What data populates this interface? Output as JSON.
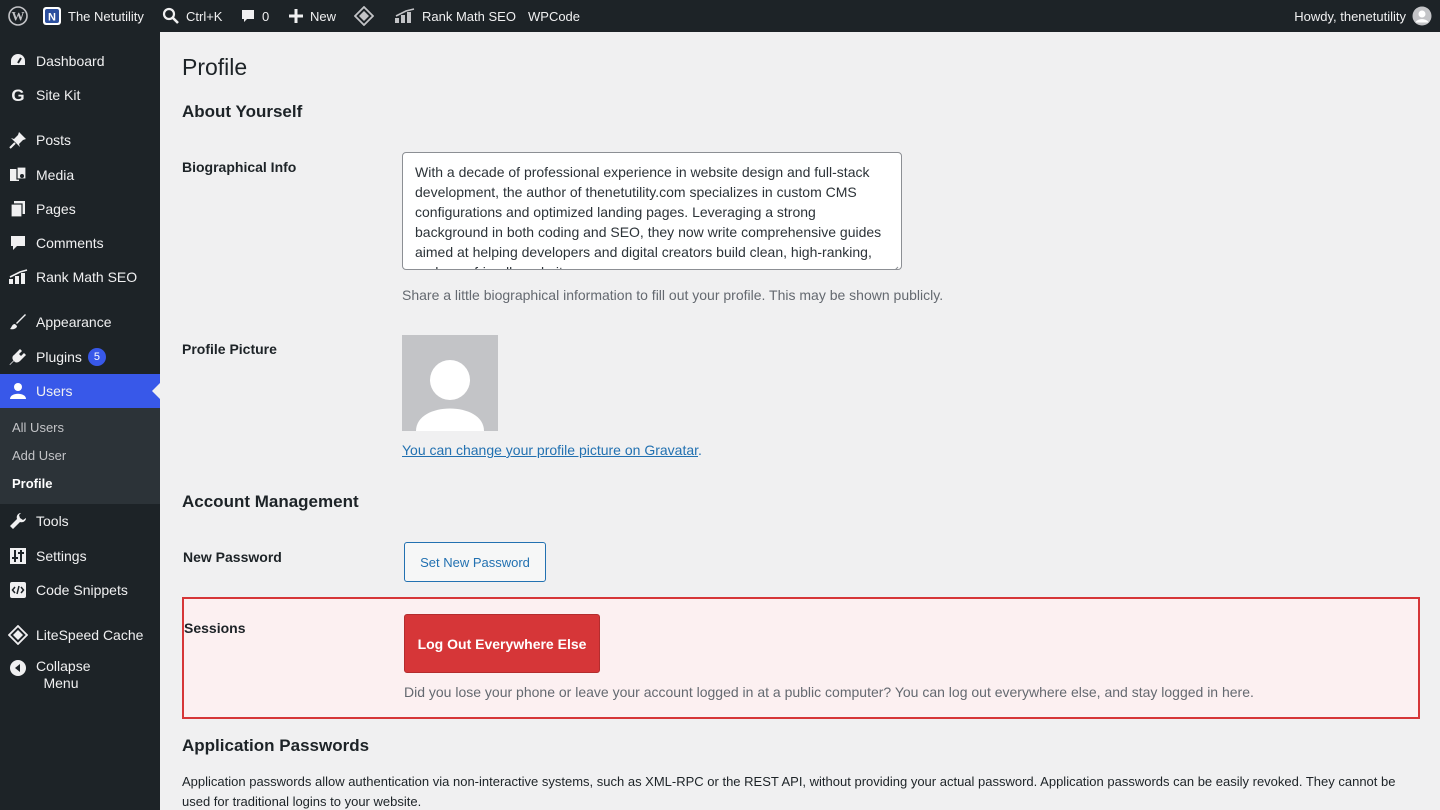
{
  "admin_bar": {
    "site_name": "The Netutility",
    "search_label": "Ctrl+K",
    "comments_count": "0",
    "new_label": "New",
    "rank_math_label": "Rank Math SEO",
    "wpcode_label": "WPCode",
    "howdy": "Howdy, thenetutility"
  },
  "sidebar": {
    "items": [
      {
        "label": "Dashboard",
        "icon": "dashboard-icon"
      },
      {
        "label": "Site Kit",
        "icon": "google-icon"
      },
      {
        "label": "Posts",
        "icon": "pin-icon"
      },
      {
        "label": "Media",
        "icon": "media-icon"
      },
      {
        "label": "Pages",
        "icon": "pages-icon"
      },
      {
        "label": "Comments",
        "icon": "comment-icon"
      },
      {
        "label": "Rank Math SEO",
        "icon": "chart-icon"
      },
      {
        "label": "Appearance",
        "icon": "brush-icon"
      },
      {
        "label": "Plugins",
        "icon": "plugin-icon",
        "badge": "5"
      },
      {
        "label": "Users",
        "icon": "user-icon"
      },
      {
        "label": "Tools",
        "icon": "wrench-icon"
      },
      {
        "label": "Settings",
        "icon": "sliders-icon"
      },
      {
        "label": "Code Snippets",
        "icon": "code-icon"
      },
      {
        "label": "LiteSpeed Cache",
        "icon": "diamond-icon"
      },
      {
        "label": "Collapse Menu",
        "icon": "collapse-icon"
      }
    ],
    "users_submenu": [
      {
        "label": "All Users"
      },
      {
        "label": "Add User"
      },
      {
        "label": "Profile"
      }
    ]
  },
  "page": {
    "title": "Profile",
    "about_heading": "About Yourself",
    "bio_label": "Biographical Info",
    "bio_text": "With a decade of professional experience in website design and full-stack development, the author of thenetutility.com specializes in custom CMS configurations and optimized landing pages. Leveraging a strong background in both coding and SEO, they now write comprehensive guides aimed at helping developers and digital creators build clean, high-ranking, and user-friendly websites.",
    "bio_desc": "Share a little biographical information to fill out your profile. This may be shown publicly.",
    "picture_label": "Profile Picture",
    "gravatar_link": "You can change your profile picture on Gravatar",
    "gravatar_period": ".",
    "account_heading": "Account Management",
    "new_password_label": "New Password",
    "set_password_button": "Set New Password",
    "sessions_label": "Sessions",
    "logout_button": "Log Out Everywhere Else",
    "sessions_desc": "Did you lose your phone or leave your account logged in at a public computer? You can log out everywhere else, and stay logged in here.",
    "app_passwords_heading": "Application Passwords",
    "app_passwords_desc": "Application passwords allow authentication via non-interactive systems, such as XML-RPC or the REST API, without providing your actual password. Application passwords can be easily revoked. They cannot be used for traditional logins to your website."
  },
  "colors": {
    "admin_bg": "#1d2327",
    "accent": "#3858e9",
    "danger": "#d63638",
    "link": "#2271b1"
  }
}
